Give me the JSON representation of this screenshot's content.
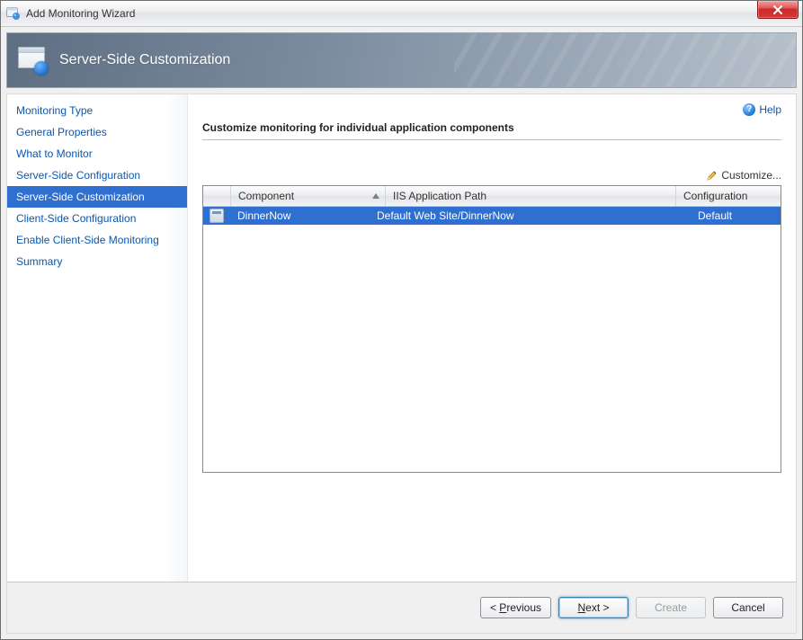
{
  "window": {
    "title": "Add Monitoring Wizard"
  },
  "banner": {
    "title": "Server-Side Customization"
  },
  "sidebar": {
    "items": [
      {
        "label": "Monitoring Type"
      },
      {
        "label": "General Properties"
      },
      {
        "label": "What to Monitor"
      },
      {
        "label": "Server-Side Configuration"
      },
      {
        "label": "Server-Side Customization"
      },
      {
        "label": "Client-Side Configuration"
      },
      {
        "label": "Enable Client-Side Monitoring"
      },
      {
        "label": "Summary"
      }
    ],
    "active_index": 4
  },
  "help": {
    "label": "Help"
  },
  "section": {
    "title": "Customize monitoring for individual application components"
  },
  "customize": {
    "label": "Customize..."
  },
  "grid": {
    "columns": {
      "component": "Component",
      "path": "IIS Application Path",
      "configuration": "Configuration"
    },
    "rows": [
      {
        "component": "DinnerNow",
        "path": "Default Web Site/DinnerNow",
        "configuration": "Default"
      }
    ]
  },
  "buttons": {
    "previous_html": "< Previous",
    "previous_ul": "P",
    "next_html": "Next >",
    "next_ul": "N",
    "create": "Create",
    "cancel": "Cancel"
  }
}
